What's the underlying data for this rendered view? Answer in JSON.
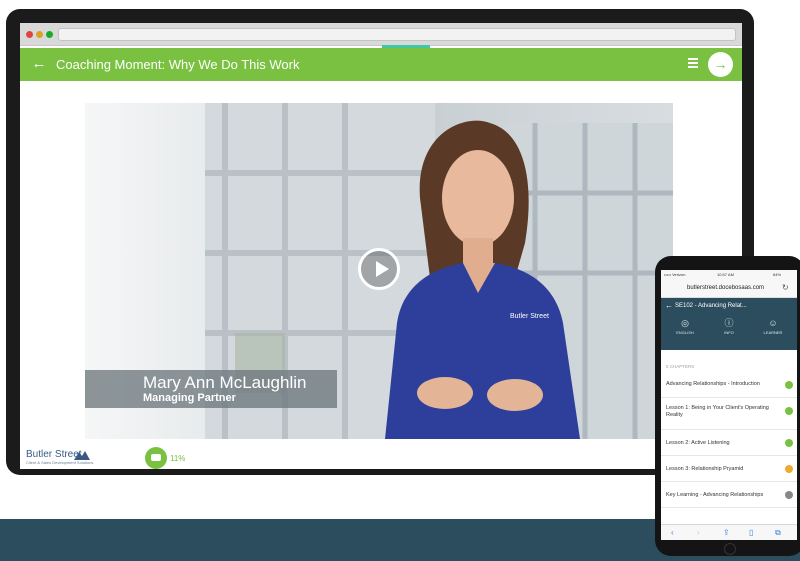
{
  "colors": {
    "accent_green": "#7ac142",
    "teal_progress": "#41c7a3",
    "navy": "#2c4d5e",
    "chapter_done": "#7ac142",
    "chapter_in_progress": "#f0a830",
    "chapter_locked": "#888888"
  },
  "desktop": {
    "header": {
      "back_icon": "arrow-left-icon",
      "title": "Coaching Moment: Why We Do This Work",
      "menu_icon": "hamburger-icon",
      "next_icon": "arrow-right-icon"
    },
    "video": {
      "play_icon": "play-icon",
      "speaker_name": "Mary Ann McLaughlin",
      "speaker_role": "Managing Partner"
    },
    "footer": {
      "logo_text": "Butler Street",
      "logo_subtitle": "Client & Sales Development Solutions",
      "chat_icon": "chat-bubble-icon",
      "progress": "11%"
    }
  },
  "mobile": {
    "status_bar": {
      "carrier": "••••• Verizon",
      "time": "10:57 AM",
      "battery": "64%"
    },
    "address": "butlerstreet.docebosaas.com",
    "reload_icon": "reload-icon",
    "course_title": "SE102 - Advancing Relat...",
    "tabs": [
      {
        "icon": "globe-icon",
        "glyph": "🌐",
        "label": "ENGLISH"
      },
      {
        "icon": "info-icon",
        "glyph": "ⓘ",
        "label": "INFO"
      },
      {
        "icon": "user-icon",
        "glyph": "☺",
        "label": "LEARNER"
      }
    ],
    "chapters_label": "5 CHAPTERS",
    "chapters": [
      {
        "label": "Advancing Relationships - Introduction",
        "status": "completed"
      },
      {
        "label": "Lesson 1: Being in Your Client's Operating Reality",
        "status": "completed"
      },
      {
        "label": "Lesson 2: Active Listening",
        "status": "completed"
      },
      {
        "label": "Lesson 3: Relationship Pryamid",
        "status": "in-progress"
      },
      {
        "label": "Key Learning - Advancing Relationships",
        "status": "not-started"
      }
    ]
  }
}
